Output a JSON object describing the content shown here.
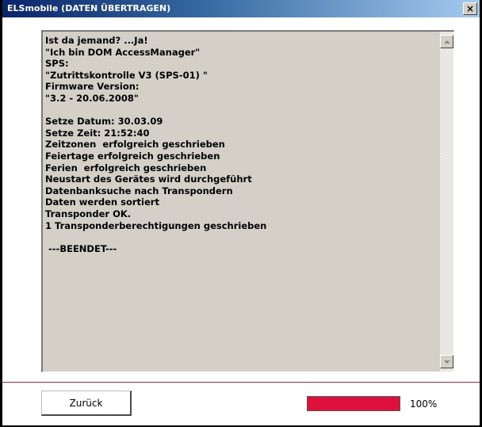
{
  "window": {
    "title": "ELSmobile (DATEN ÜBERTRAGEN)",
    "close_label": "×"
  },
  "log": {
    "text": "Ist da jemand? ...Ja!\n\"Ich bin DOM AccessManager\"\nSPS:\n\"Zutrittskontrolle V3 (SPS-01) \"\nFirmware Version:\n\"3.2 - 20.06.2008\"\n\nSetze Datum: 30.03.09\nSetze Zeit: 21:52:40\nZeitzonen  erfolgreich geschrieben\nFeiertage erfolgreich geschrieben\nFerien  erfolgreich geschrieben\nNeustart des Gerätes wird durchgeführt\nDatenbanksuche nach Transpondern\nDaten werden sortiert\nTransponder OK.\n1 Transponderberechtigungen geschrieben\n\n ---BEENDET---"
  },
  "footer": {
    "back_label": "Zurück",
    "progress_text": "100%",
    "progress_fraction": 1.0
  },
  "colors": {
    "accent_red": "#e0103c",
    "divider_red": "#d4203a",
    "title_bar": "#0a246a"
  },
  "icons": {
    "close": "close-icon",
    "scroll_up": "scroll-up-arrow-icon",
    "scroll_down": "scroll-down-arrow-icon"
  }
}
